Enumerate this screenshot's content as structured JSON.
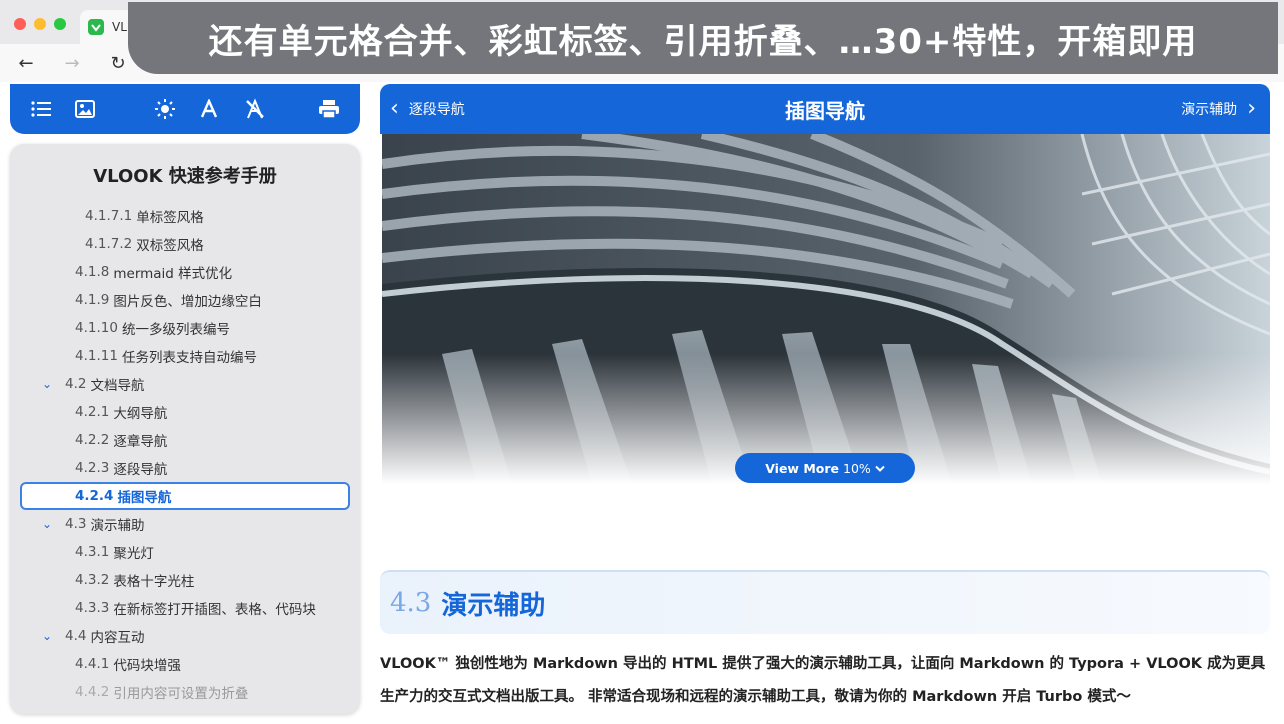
{
  "browser": {
    "tab_title": "VL",
    "back_glyph": "←",
    "forward_glyph": "→",
    "reload_glyph": "↻"
  },
  "banner": {
    "text": "还有单元格合并、彩虹标签、引用折叠、…30+特性，开箱即用"
  },
  "toolbar": {
    "icons": [
      "list-icon",
      "image-icon",
      "sun-icon",
      "font-icon",
      "clear-format-icon",
      "print-icon"
    ]
  },
  "toc": {
    "title": "VLOOK 快速参考手册",
    "items": [
      {
        "num": "4.1.7.1",
        "label": "单标签风格",
        "level": 4
      },
      {
        "num": "4.1.7.2",
        "label": "双标签风格",
        "level": 4
      },
      {
        "num": "4.1.8",
        "label": "mermaid 样式优化",
        "level": 3
      },
      {
        "num": "4.1.9",
        "label": "图片反色、增加边缘空白",
        "level": 3
      },
      {
        "num": "4.1.10",
        "label": "统一多级列表编号",
        "level": 3
      },
      {
        "num": "4.1.11",
        "label": "任务列表支持自动编号",
        "level": 3
      },
      {
        "num": "4.2",
        "label": "文档导航",
        "level": 2
      },
      {
        "num": "4.2.1",
        "label": "大纲导航",
        "level": 3
      },
      {
        "num": "4.2.2",
        "label": "逐章导航",
        "level": 3
      },
      {
        "num": "4.2.3",
        "label": "逐段导航",
        "level": 3
      },
      {
        "num": "4.2.4",
        "label": "插图导航",
        "level": 3
      },
      {
        "num": "4.3",
        "label": "演示辅助",
        "level": 2
      },
      {
        "num": "4.3.1",
        "label": "聚光灯",
        "level": 3
      },
      {
        "num": "4.3.2",
        "label": "表格十字光柱",
        "level": 3
      },
      {
        "num": "4.3.3",
        "label": "在新标签打开插图、表格、代码块",
        "level": 3
      },
      {
        "num": "4.4",
        "label": "内容互动",
        "level": 2
      },
      {
        "num": "4.4.1",
        "label": "代码块增强",
        "level": 3
      },
      {
        "num": "4.4.2",
        "label": "引用内容可设置为折叠",
        "level": 3
      }
    ],
    "expand_glyph": "⌄"
  },
  "content_header": {
    "prev_label": "逐段导航",
    "title": "插图导航",
    "next_label": "演示辅助",
    "prev_glyph": "‹",
    "next_glyph": "›"
  },
  "figure": {
    "view_more_label": "View More",
    "view_more_percent": "10%",
    "progress": 0.1
  },
  "section": {
    "number": "4.3",
    "title": "演示辅助",
    "paragraph": "VLOOK™ 独创性地为 Markdown 导出的 HTML 提供了强大的演示辅助工具，让面向 Markdown 的 Typora + VLOOK 成为更具生产力的交互式文档出版工具。 非常适合现场和远程的演示辅助工具，敬请为你的 Markdown 开启 Turbo 模式～"
  },
  "colors": {
    "accent": "#1466d9",
    "toc_bg": "#e7e7e9",
    "banner_bg": "#6e7076"
  }
}
